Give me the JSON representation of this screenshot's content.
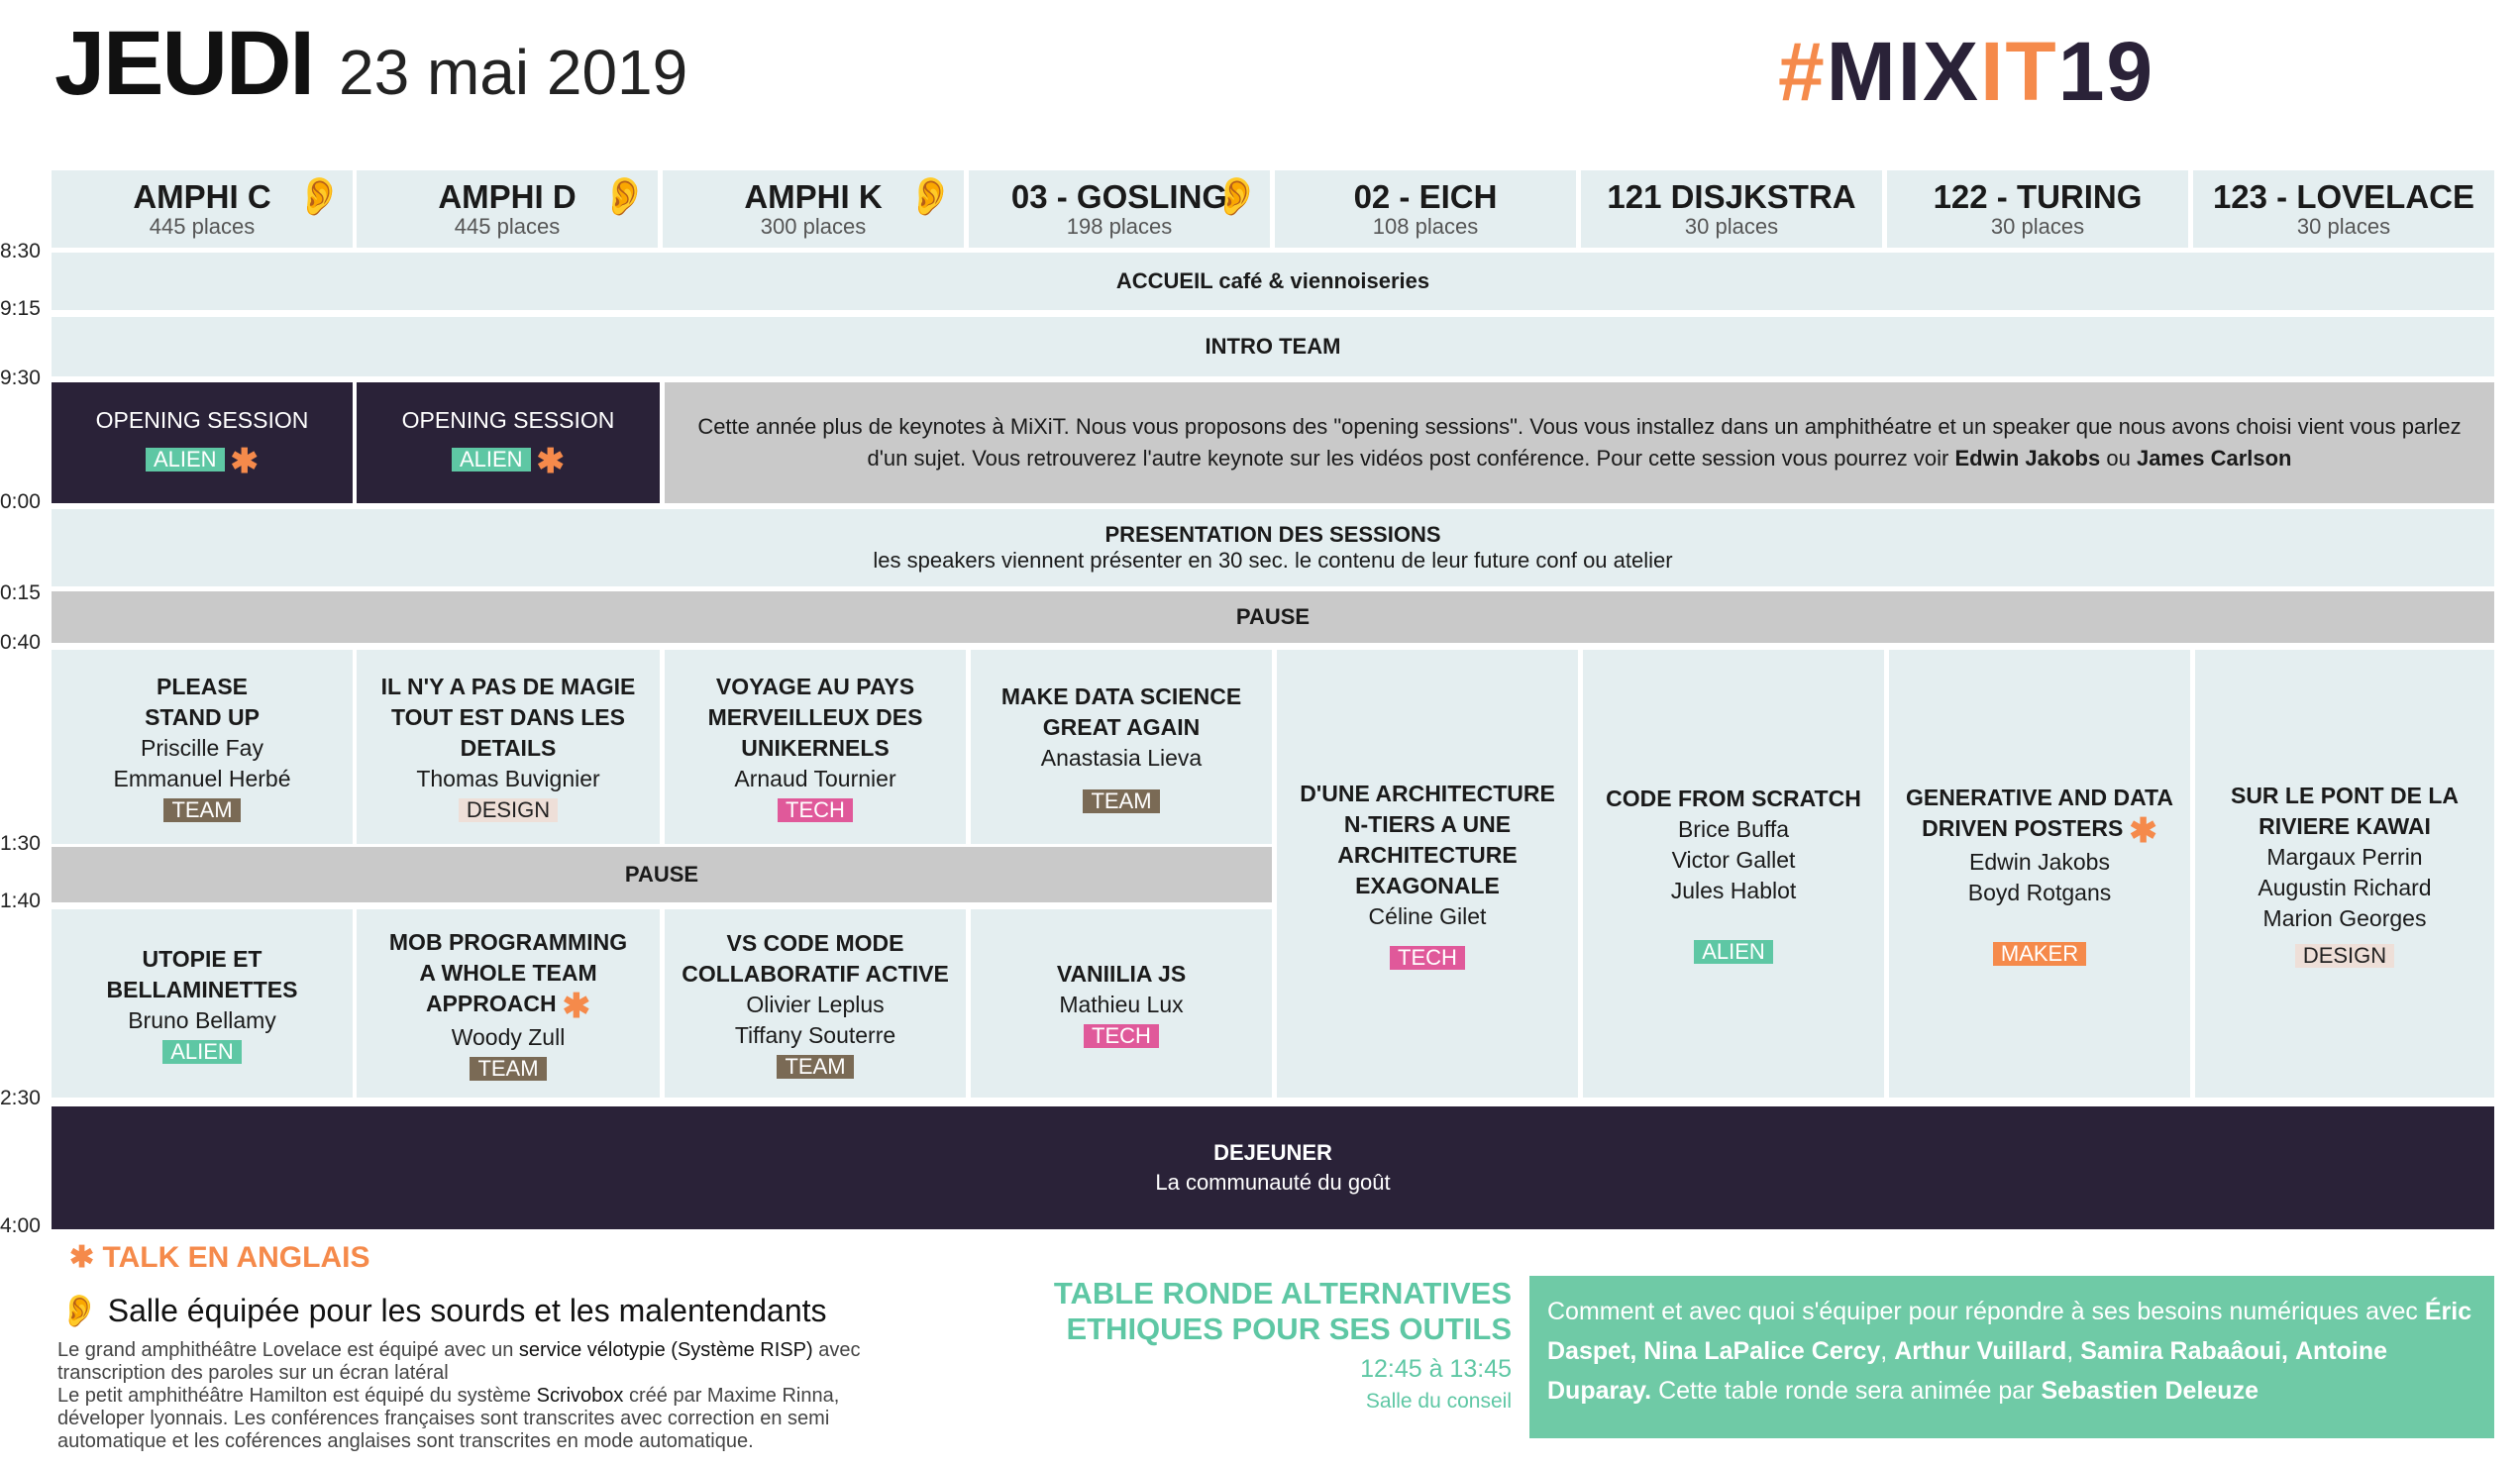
{
  "header": {
    "day": "JEUDI",
    "date": "23 mai 2019",
    "logo_hash": "#",
    "logo_mix": "MIX",
    "logo_it": "IT",
    "logo_year": "19"
  },
  "rooms": [
    {
      "name": "AMPHI C",
      "cap": "445 places",
      "ear": true
    },
    {
      "name": "AMPHI D",
      "cap": "445 places",
      "ear": true
    },
    {
      "name": "AMPHI K",
      "cap": "300 places",
      "ear": true
    },
    {
      "name": "03 - GOSLING",
      "cap": "198 places",
      "ear": true
    },
    {
      "name": "02 - EICH",
      "cap": "108 places",
      "ear": false
    },
    {
      "name": "121 DISJKSTRA",
      "cap": "30 places",
      "ear": false
    },
    {
      "name": "122 - TURING",
      "cap": "30 places",
      "ear": false
    },
    {
      "name": "123 - LOVELACE",
      "cap": "30 places",
      "ear": false
    }
  ],
  "times": [
    "8:30",
    "9:15",
    "9:30",
    "0:00",
    "0:15",
    "0:40",
    "1:30",
    "1:40",
    "2:30",
    "4:00"
  ],
  "ear_glyph": "👂",
  "star_glyph": "✱",
  "bars": {
    "accueil": "ACCUEIL café & viennoiseries",
    "intro": "INTRO TEAM",
    "presentation_title": "PRESENTATION DES SESSIONS",
    "presentation_sub": "les speakers viennent présenter en 30 sec. le contenu de leur future conf ou atelier",
    "pause1": "PAUSE",
    "pause2": "PAUSE",
    "dejeuner_title": "DEJEUNER",
    "dejeuner_sub": "La communauté du goût"
  },
  "opening": {
    "title": "OPENING SESSION",
    "tag": "ALIEN",
    "info_text": "Cette année plus de keynotes à MiXiT. Nous vous proposons des \"opening sessions\". Vous vous installez dans un amphithéatre et un speaker que nous avons choisi vient vous parlez d'un sujet. Vous retrouverez l'autre keynote sur les vidéos post conférence. Pour cette session vous pourrez voir",
    "speaker1": "Edwin Jakobs",
    "ou": "ou",
    "speaker2": "James Carlson"
  },
  "sessions": {
    "s1": {
      "title1": "PLEASE",
      "title2": "STAND UP",
      "sp1": "Priscille Fay",
      "sp2": "Emmanuel Herbé",
      "tag": "TEAM"
    },
    "s2": {
      "title1": "IL N'Y A PAS DE MAGIE",
      "title2": "TOUT EST DANS LES",
      "title3": "DETAILS",
      "sp1": "Thomas Buvignier",
      "tag": "DESIGN"
    },
    "s3": {
      "title1": "VOYAGE AU PAYS",
      "title2": "MERVEILLEUX DES",
      "title3": "UNIKERNELS",
      "sp1": "Arnaud Tournier",
      "tag": "TECH"
    },
    "s4": {
      "title1": "MAKE DATA SCIENCE",
      "title2": "GREAT AGAIN",
      "sp1": "Anastasia Lieva",
      "tag": "TEAM"
    },
    "s5": {
      "title1": "D'UNE ARCHITECTURE",
      "title2": "N-TIERS A UNE",
      "title3": "ARCHITECTURE",
      "title4": "EXAGONALE",
      "sp1": "Céline Gilet",
      "tag": "TECH"
    },
    "s6": {
      "title1": "CODE FROM SCRATCH",
      "sp1": "Brice Buffa",
      "sp2": "Victor Gallet",
      "sp3": "Jules Hablot",
      "tag": "ALIEN"
    },
    "s7": {
      "title1": "GENERATIVE AND DATA",
      "title2": "DRIVEN POSTERS",
      "sp1": "Edwin Jakobs",
      "sp2": "Boyd Rotgans",
      "tag": "MAKER"
    },
    "s8": {
      "title1": "SUR LE PONT DE LA",
      "title2": "RIVIERE KAWAI",
      "sp1": "Margaux Perrin",
      "sp2": "Augustin Richard",
      "sp3": "Marion Georges",
      "tag": "DESIGN"
    },
    "s9": {
      "title1": "UTOPIE ET",
      "title2": "BELLAMINETTES",
      "sp1": "Bruno Bellamy",
      "tag": "ALIEN"
    },
    "s10": {
      "title1": "MOB PROGRAMMING",
      "title2": "A WHOLE TEAM",
      "title3": "APPROACH",
      "sp1": "Woody Zull",
      "tag": "TEAM"
    },
    "s11": {
      "title1": "VS CODE MODE",
      "title2": "COLLABORATIF ACTIVE",
      "sp1": "Olivier Leplus",
      "sp2": "Tiffany Souterre",
      "tag": "TEAM"
    },
    "s12": {
      "title1": "VANIILIA JS",
      "sp1": "Mathieu Lux",
      "tag": "TECH"
    }
  },
  "legend": {
    "star_label": "TALK EN ANGLAIS",
    "ear_label": "Salle équipée pour les sourds et les malentendants",
    "line1a": "Le grand amphithéâtre Lovelace est équipé avec un ",
    "line1b": "service vélotypie (Système RISP)",
    "line1c": " avec",
    "line2": "transcription des paroles sur un écran latéral",
    "line3a": "Le petit amphithéâtre Hamilton est équipé du système ",
    "line3b": "Scrivobox",
    "line3c": " créé par Maxime Rinna,",
    "line4": "déveloper lyonnais. Les conférences françaises sont transcrites avec correction en semi",
    "line5": "automatique et les coférences anglaises sont transcrites en mode automatique."
  },
  "table_ronde": {
    "title1": "TABLE RONDE ALTERNATIVES",
    "title2": "ETHIQUES POUR SES OUTILS",
    "time": "12:45 à 13:45",
    "room": "Salle du conseil",
    "t1": "Comment et avec quoi s'équiper pour répondre à ses besoins numériques",
    "t2": "avec ",
    "n1": "Éric Daspet, Nina LaPalice Cercy",
    "c1": ", ",
    "n2": "Arthur Vuillard",
    "c2": ", ",
    "n3": "Samira Rabaâoui,",
    "n4": "Antoine Duparay.",
    "t3": " Cette table ronde sera animée par ",
    "n5": "Sebastien Deleuze"
  },
  "colors": {
    "cell_bg": "#e4eef0",
    "dark": "#2a2238",
    "grey": "#c9c9c9",
    "orange": "#f58a4b",
    "green": "#5ec7a4",
    "pink": "#e0599a",
    "team": "#7a6a55",
    "design": "#eedfd8",
    "green_box": "#6fcaa6"
  }
}
